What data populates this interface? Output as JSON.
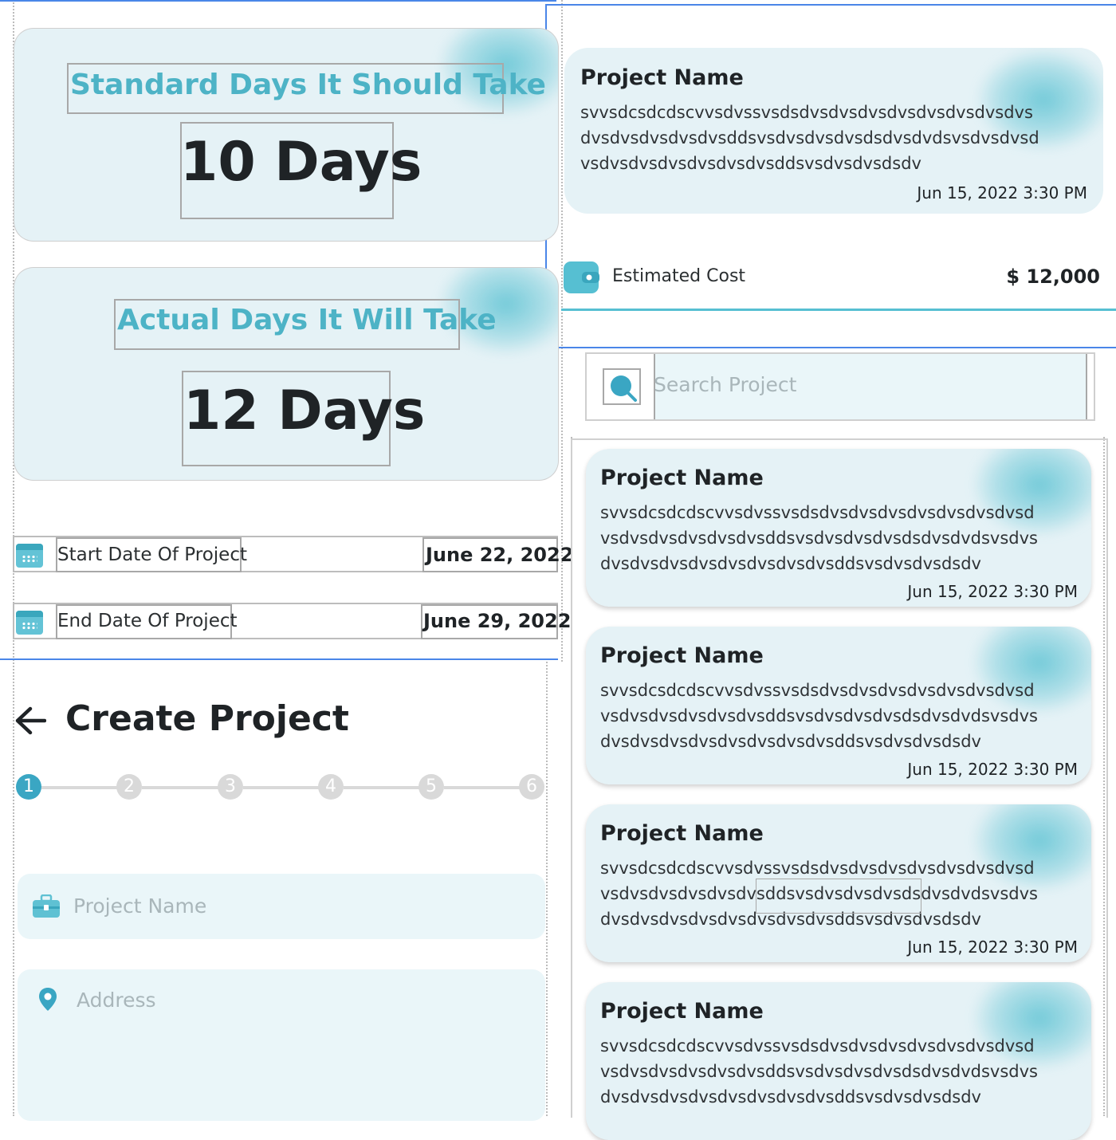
{
  "days_panel": {
    "standard": {
      "title": "Standard Days It Should Take",
      "value": "10 Days"
    },
    "actual": {
      "title": "Actual Days It Will Take",
      "value": "12 Days"
    },
    "start": {
      "label": "Start Date Of Project",
      "value": "June 22, 2022",
      "icon": "calendar-icon"
    },
    "end": {
      "label": "End Date Of Project",
      "value": "June 29, 2022",
      "icon": "calendar-icon"
    }
  },
  "create_project": {
    "title": "Create Project",
    "back_icon": "arrow-left-icon",
    "steps": [
      "1",
      "2",
      "3",
      "4",
      "5",
      "6"
    ],
    "active_step": 1,
    "fields": [
      {
        "placeholder": "Project Name",
        "icon": "briefcase-icon"
      },
      {
        "placeholder": "Address",
        "icon": "location-pin-icon"
      }
    ]
  },
  "detail_card": {
    "name": "Project Name",
    "desc": [
      "svvsdcsdcdscvvsdvssvsdsdvsdvsdvsdvsdvsdvsdvsdvs",
      "dvsdvsdvsdvsdvsddsvsdvsdvsdvsdsdvsdvdsvsdvsdvsd",
      "vsdvsdvsdvsdvsdvsdvsddsvsdvsdvsdsdv"
    ],
    "date": "Jun 15, 2022 3:30 PM",
    "cost_label": "Estimated Cost",
    "cost_value": "$ 12,000",
    "cost_icon": "wallet-icon"
  },
  "search": {
    "placeholder": "Search Project",
    "icon": "search-icon"
  },
  "project_list": [
    {
      "name": "Project Name",
      "desc": [
        "svvsdcsdcdscvvsdvssvsdsdvsdvsdvsdvsdvsdvsdvsd",
        "vsdvsdvsdvsdvsdvsddsvsdvsdvsdvsdsdvsdvdsvsdvs",
        "dvsdvsdvsdvsdvsdvsdvsdvsddsvsdvsdvsdsdv"
      ],
      "date": "Jun 15, 2022 3:30 PM"
    },
    {
      "name": "Project Name",
      "desc": [
        "svvsdcsdcdscvvsdvssvsdsdvsdvsdvsdvsdvsdvsdvsd",
        "vsdvsdvsdvsdvsdvsddsvsdvsdvsdvsdsdvsdvdsvsdvs",
        "dvsdvsdvsdvsdvsdvsdvsdvsddsvsdvsdvsdsdv"
      ],
      "date": "Jun 15, 2022 3:30 PM"
    },
    {
      "name": "Project Name",
      "desc": [
        "svvsdcsdcdscvvsdvssvsdsdvsdvsdvsdvsdvsdvsdvsd",
        "vsdvsdvsdvsdvsdvsddsvsdvsdvsdvsdsdvsdvdsvsdvs",
        "dvsdvsdvsdvsdvsdvsdvsdvsddsvsdvsdvsdsdv"
      ],
      "date": "Jun 15, 2022 3:30 PM"
    },
    {
      "name": "Project Name",
      "desc": [
        "svvsdcsdcdscvvsdvssvsdsdvsdvsdvsdvsdvsdvsdvsd",
        "vsdvsdvsdvsdvsdvsddsvsdvsdvsdvsdsdvsdvdsvsdvs",
        "dvsdvsdvsdvsdvsdvsdvsdvsddsvsdvsdvsdsdv"
      ],
      "date": ""
    }
  ],
  "colors": {
    "accent": "#3aa6c3",
    "title_accent": "#4db3c6",
    "card_bg": "#e5f2f6",
    "field_bg": "#eaf6f9",
    "inactive_step": "#d9d9d9"
  }
}
